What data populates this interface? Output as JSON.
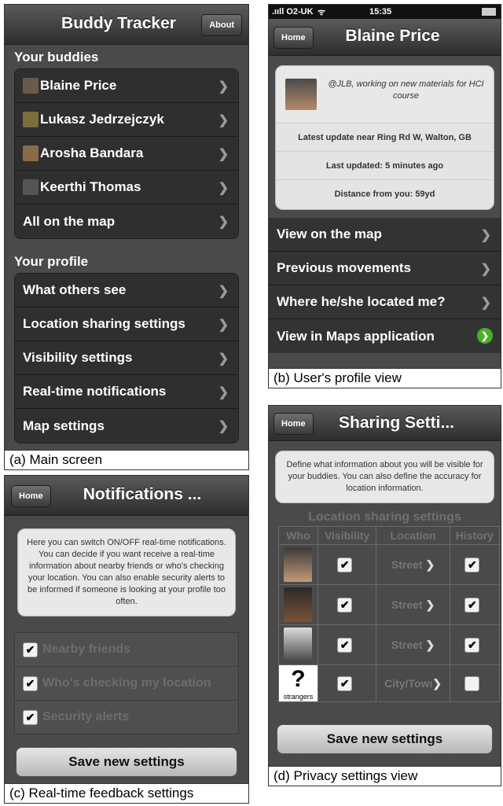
{
  "main": {
    "title": "Buddy Tracker",
    "about_label": "About",
    "buddies_header": "Your buddies",
    "buddies": [
      {
        "name": "Blaine Price",
        "avatar_color": "#6b5a4a"
      },
      {
        "name": "Lukasz Jedrzejczyk",
        "avatar_color": "#7a6f3a"
      },
      {
        "name": "Arosha Bandara",
        "avatar_color": "#8a6a4a"
      },
      {
        "name": "Keerthi Thomas",
        "avatar_color": "#555555"
      }
    ],
    "all_on_map": "All on the map",
    "profile_header": "Your profile",
    "profile_items": [
      "What others see",
      "Location sharing settings",
      "Visibility settings",
      "Real-time notifications",
      "Map settings"
    ],
    "caption": "(a) Main screen"
  },
  "profile": {
    "status_bar": {
      "carrier": ".ııll O2-UK",
      "time": "15:35"
    },
    "home_label": "Home",
    "title": "Blaine Price",
    "status_text": "@JLB, working on new materials for HCI course",
    "latest_update": "Latest update near Ring Rd W, Walton, GB",
    "last_updated": "Last updated: 5 minutes ago",
    "distance": "Distance from you: 59yd",
    "actions": [
      "View on the map",
      "Previous movements",
      "Where he/she located me?",
      "View in Maps application"
    ],
    "caption": "(b) User's profile view"
  },
  "notifications": {
    "home_label": "Home",
    "title": "Notifications ...",
    "info": "Here you can switch ON/OFF real-time notifications. You can decide if you want receive a real-time information about nearby friends or who's checking your location. You can also enable security alerts to be informed if someone is looking at your profile too often.",
    "options": [
      "Nearby friends",
      "Who's checking my location",
      "Security alerts"
    ],
    "save_label": "Save new settings",
    "caption": "(c) Real-time feedback settings"
  },
  "sharing": {
    "home_label": "Home",
    "title": "Sharing Setti...",
    "info": "Define what information about you will be visible for your buddies. You can also define the accuracy for location information.",
    "table_title": "Location sharing settings",
    "columns": [
      "Who",
      "Visibility",
      "Location",
      "History"
    ],
    "rows": [
      {
        "location": "Street",
        "history": true
      },
      {
        "location": "Street",
        "history": true
      },
      {
        "location": "Street",
        "history": true
      },
      {
        "location": "City/Towı",
        "history": false,
        "who_label": "strangers"
      }
    ],
    "save_label": "Save new settings",
    "caption": "(d) Privacy settings view"
  },
  "colors": {
    "bar": "#3a3a3a",
    "group": "#2f2f2f",
    "accent_green": "#4caf2a"
  }
}
